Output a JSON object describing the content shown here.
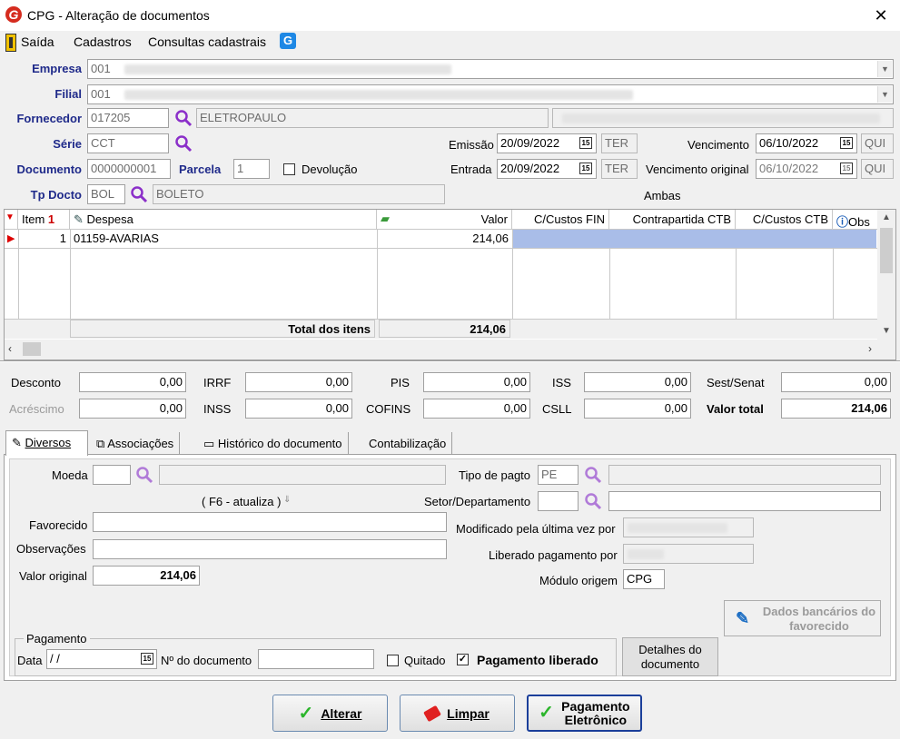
{
  "window": {
    "title": "CPG - Alteração de documentos",
    "logo": "G"
  },
  "menu": {
    "saida": "Saída",
    "cadastros": "Cadastros",
    "consultas": "Consultas cadastrais"
  },
  "header": {
    "empresa_label": "Empresa",
    "empresa_value": "001",
    "filial_label": "Filial",
    "filial_value": "001",
    "fornecedor_label": "Fornecedor",
    "fornecedor_code": "017205",
    "fornecedor_name": "ELETROPAULO",
    "serie_label": "Série",
    "serie_value": "CCT",
    "documento_label": "Documento",
    "documento_value": "0000000001",
    "parcela_label": "Parcela",
    "parcela_value": "1",
    "devolucao_label": "Devolução",
    "tpdocto_label": "Tp Docto",
    "tpdocto_code": "BOL",
    "tpdocto_name": "BOLETO",
    "emissao_label": "Emissão",
    "emissao_value": "20/09/2022",
    "emissao_day": "TER",
    "entrada_label": "Entrada",
    "entrada_value": "20/09/2022",
    "entrada_day": "TER",
    "vencimento_label": "Vencimento",
    "vencimento_value": "06/10/2022",
    "vencimento_day": "QUI",
    "venc_original_label": "Vencimento original",
    "venc_original_value": "06/10/2022",
    "venc_original_day": "QUI",
    "ambas": "Ambas",
    "cal_glyph": "15"
  },
  "grid": {
    "columns": {
      "item": "Item",
      "item_sort": "1",
      "despesa": "Despesa",
      "valor": "Valor",
      "cc_fin": "C/Custos FIN",
      "contrapartida": "Contrapartida CTB",
      "cc_ctb": "C/Custos CTB",
      "obs": "Obs"
    },
    "rows": [
      {
        "item": "1",
        "despesa": "01159-AVARIAS",
        "valor": "214,06"
      }
    ],
    "total_label": "Total dos itens",
    "total_value": "214,06"
  },
  "totals": {
    "desconto_label": "Desconto",
    "desconto": "0,00",
    "acrescimo_label": "Acréscimo",
    "acrescimo": "0,00",
    "irrf_label": "IRRF",
    "irrf": "0,00",
    "inss_label": "INSS",
    "inss": "0,00",
    "pis_label": "PIS",
    "pis": "0,00",
    "cofins_label": "COFINS",
    "cofins": "0,00",
    "iss_label": "ISS",
    "iss": "0,00",
    "csll_label": "CSLL",
    "csll": "0,00",
    "sest_label": "Sest/Senat",
    "sest": "0,00",
    "valor_total_label": "Valor total",
    "valor_total": "214,06"
  },
  "tabs": [
    "Diversos",
    "Associações",
    "Histórico do documento",
    "Contabilização"
  ],
  "diversos": {
    "moeda_label": "Moeda",
    "f6_hint": "( F6 - atualiza )",
    "favorecido_label": "Favorecido",
    "observacoes_label": "Observações",
    "valor_original_label": "Valor original",
    "valor_original": "214,06",
    "tipo_pagto_label": "Tipo de pagto",
    "tipo_pagto_value": "PE",
    "setor_label": "Setor/Departamento",
    "modificado_label": "Modificado pela última vez por",
    "liberado_label": "Liberado pagamento por",
    "modulo_label": "Módulo origem",
    "modulo_value": "CPG",
    "dados_bancarios": "Dados bancários do favorecido",
    "pagamento_legend": "Pagamento",
    "data_label": "Data",
    "data_value": " /  /",
    "ndoc_label": "Nº do documento",
    "quitado_label": "Quitado",
    "pag_liberado_label": "Pagamento liberado",
    "detalhes_label": "Detalhes do documento"
  },
  "buttons": {
    "alterar": "Alterar",
    "limpar": "Limpar",
    "pag_eletronico": "Pagamento Eletrônico"
  },
  "colors": {
    "label_blue": "#1f2a8a",
    "selection": "#a9bde8",
    "magnifier": "#8b2fc9",
    "accent_red": "#d52b1e"
  }
}
